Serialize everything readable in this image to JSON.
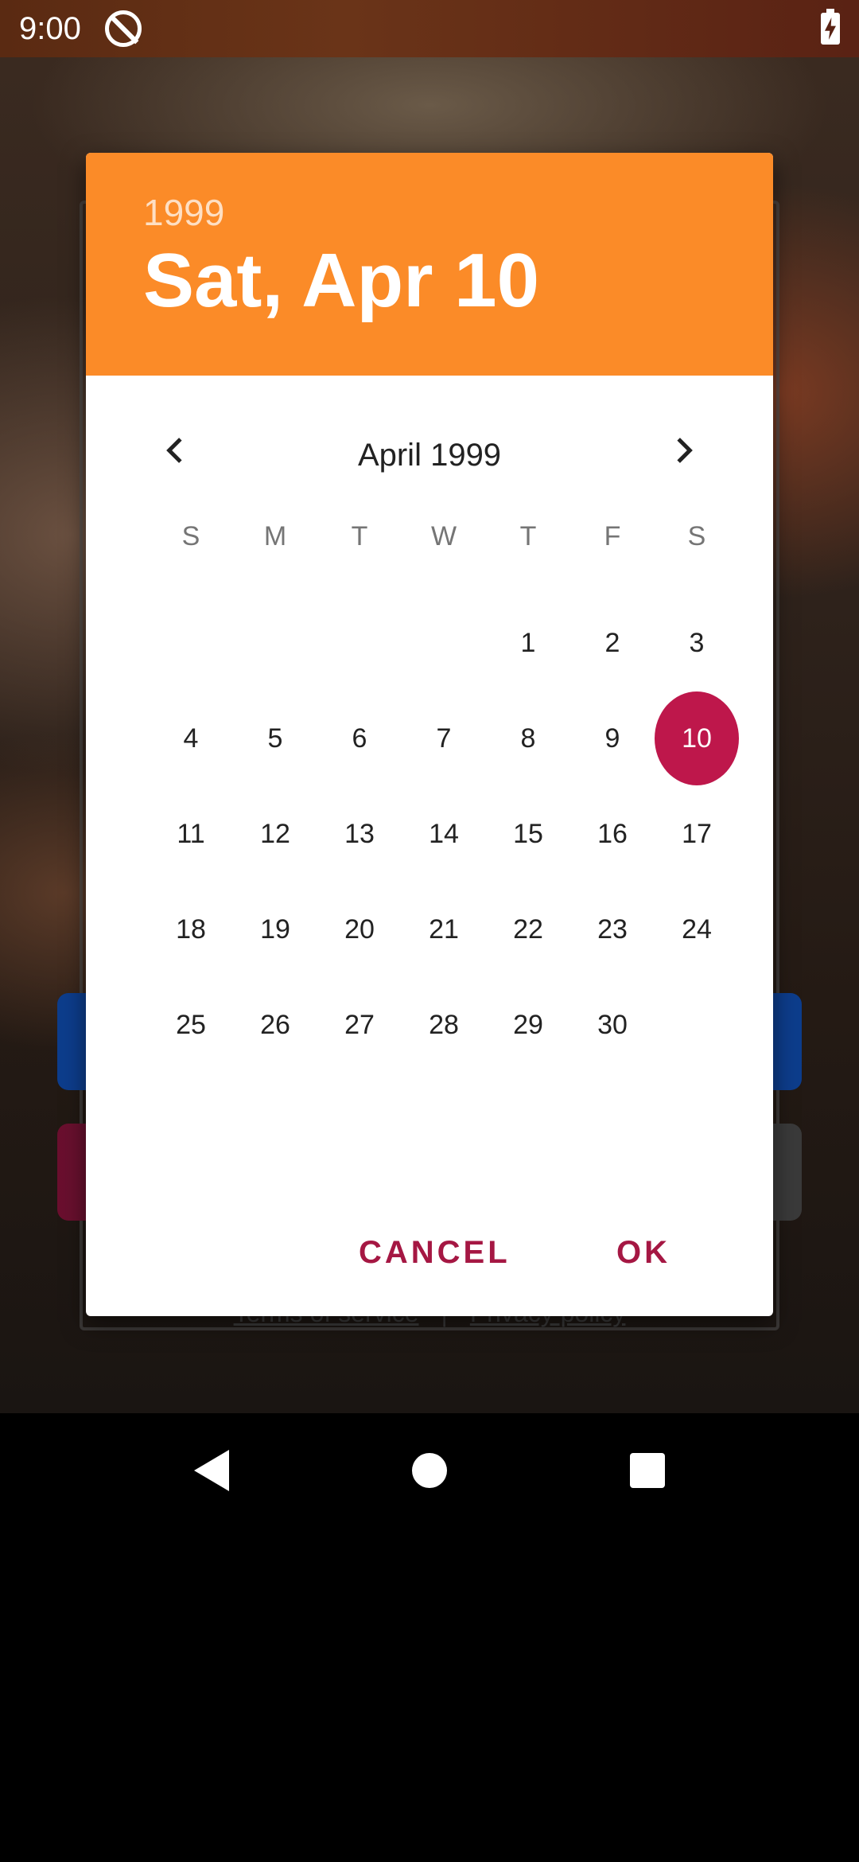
{
  "status_bar": {
    "time": "9:00",
    "icons": [
      "app-notification-icon",
      "battery-charging-icon"
    ]
  },
  "background": {
    "links": {
      "terms": "Terms of service",
      "separator": "|",
      "privacy": "Privacy policy"
    }
  },
  "dialog": {
    "header": {
      "year": "1999",
      "date": "Sat, Apr 10"
    },
    "month_label": "April 1999",
    "weekdays": [
      "S",
      "M",
      "T",
      "W",
      "T",
      "F",
      "S"
    ],
    "days": [
      [
        "",
        "",
        "",
        "",
        "1",
        "2",
        "3"
      ],
      [
        "4",
        "5",
        "6",
        "7",
        "8",
        "9",
        "10"
      ],
      [
        "11",
        "12",
        "13",
        "14",
        "15",
        "16",
        "17"
      ],
      [
        "18",
        "19",
        "20",
        "21",
        "22",
        "23",
        "24"
      ],
      [
        "25",
        "26",
        "27",
        "28",
        "29",
        "30",
        ""
      ]
    ],
    "selected_day": "10",
    "buttons": {
      "cancel": "CANCEL",
      "ok": "OK"
    }
  },
  "colors": {
    "header": "#fb8b28",
    "selected": "#be174b",
    "button_text": "#a51743"
  }
}
